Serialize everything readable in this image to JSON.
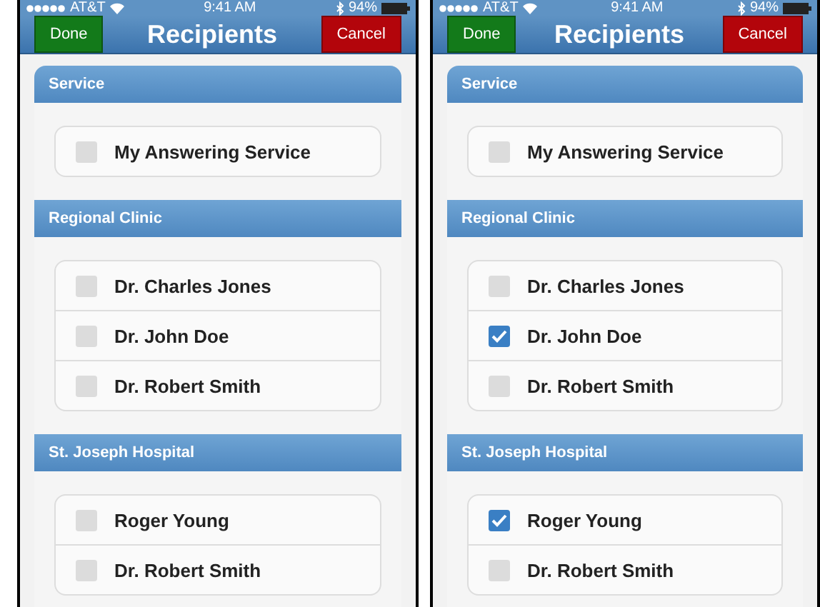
{
  "phones": [
    {
      "status": {
        "carrier": "AT&T",
        "time": "9:41 AM",
        "battery": "94%"
      },
      "nav": {
        "done": "Done",
        "title": "Recipients",
        "cancel": "Cancel"
      },
      "sections": [
        {
          "title": "Service",
          "items": [
            {
              "label": "My Answering Service",
              "checked": false
            }
          ]
        },
        {
          "title": "Regional Clinic",
          "items": [
            {
              "label": "Dr. Charles Jones",
              "checked": false
            },
            {
              "label": "Dr. John Doe",
              "checked": false
            },
            {
              "label": "Dr. Robert Smith",
              "checked": false
            }
          ]
        },
        {
          "title": "St. Joseph Hospital",
          "items": [
            {
              "label": "Roger Young",
              "checked": false
            },
            {
              "label": "Dr. Robert Smith",
              "checked": false
            }
          ]
        }
      ]
    },
    {
      "status": {
        "carrier": "AT&T",
        "time": "9:41 AM",
        "battery": "94%"
      },
      "nav": {
        "done": "Done",
        "title": "Recipients",
        "cancel": "Cancel"
      },
      "sections": [
        {
          "title": "Service",
          "items": [
            {
              "label": "My Answering Service",
              "checked": false
            }
          ]
        },
        {
          "title": "Regional Clinic",
          "items": [
            {
              "label": "Dr. Charles Jones",
              "checked": false
            },
            {
              "label": "Dr. John Doe",
              "checked": true
            },
            {
              "label": "Dr. Robert Smith",
              "checked": false
            }
          ]
        },
        {
          "title": "St. Joseph Hospital",
          "items": [
            {
              "label": "Roger Young",
              "checked": true
            },
            {
              "label": "Dr. Robert Smith",
              "checked": false
            }
          ]
        }
      ]
    }
  ]
}
